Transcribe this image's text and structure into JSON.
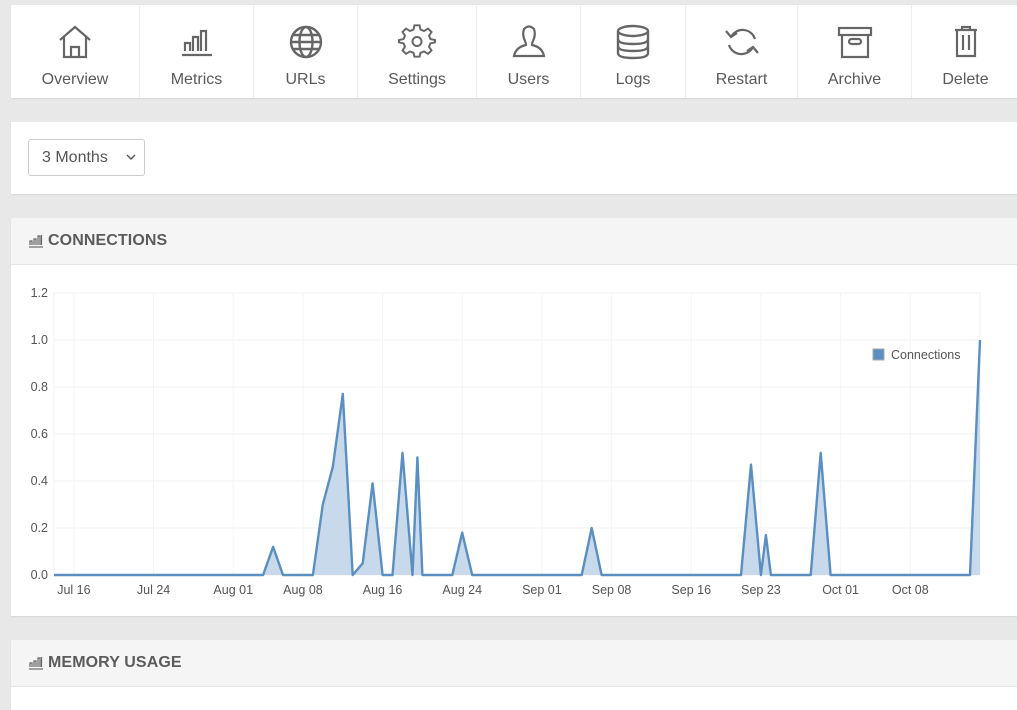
{
  "toolbar": {
    "items": [
      {
        "label": "Overview",
        "icon": "home-icon"
      },
      {
        "label": "Metrics",
        "icon": "bar-chart-icon"
      },
      {
        "label": "URLs",
        "icon": "globe-icon"
      },
      {
        "label": "Settings",
        "icon": "gear-icon"
      },
      {
        "label": "Users",
        "icon": "user-icon"
      },
      {
        "label": "Logs",
        "icon": "database-icon"
      },
      {
        "label": "Restart",
        "icon": "refresh-icon"
      },
      {
        "label": "Archive",
        "icon": "archive-box-icon"
      },
      {
        "label": "Delete",
        "icon": "trash-icon"
      }
    ]
  },
  "filter": {
    "range_selected": "3 Months"
  },
  "panels": {
    "connections_title": "CONNECTIONS",
    "memory_title": "MEMORY USAGE"
  },
  "colors": {
    "series_line": "#5b8fc0",
    "series_fill": "#c4d7ea"
  },
  "chart_data": {
    "type": "area",
    "title": "CONNECTIONS",
    "xlabel": "",
    "ylabel": "",
    "ylim": [
      0,
      1.2
    ],
    "yticks": [
      "0.0",
      "0.2",
      "0.4",
      "0.6",
      "0.8",
      "1.0",
      "1.2"
    ],
    "xticks": [
      "Jul 16",
      "Jul 24",
      "Aug 01",
      "Aug 08",
      "Aug 16",
      "Aug 24",
      "Sep 01",
      "Sep 08",
      "Sep 16",
      "Sep 23",
      "Oct 01",
      "Oct 08"
    ],
    "grid": true,
    "legend": {
      "position": "top-right",
      "entries": [
        "Connections"
      ]
    },
    "series": [
      {
        "name": "Connections",
        "points": [
          [
            "Jul 14",
            0
          ],
          [
            "Aug 04",
            0
          ],
          [
            "Aug 05",
            0.12
          ],
          [
            "Aug 06",
            0
          ],
          [
            "Aug 09",
            0
          ],
          [
            "Aug 10",
            0.3
          ],
          [
            "Aug 11",
            0.46
          ],
          [
            "Aug 12",
            0.77
          ],
          [
            "Aug 13",
            0
          ],
          [
            "Aug 14",
            0.05
          ],
          [
            "Aug 15",
            0.39
          ],
          [
            "Aug 16",
            0
          ],
          [
            "Aug 17",
            0
          ],
          [
            "Aug 18",
            0.52
          ],
          [
            "Aug 19",
            0
          ],
          [
            "Aug 19b",
            0.5
          ],
          [
            "Aug 20",
            0
          ],
          [
            "Aug 23",
            0
          ],
          [
            "Aug 24",
            0.18
          ],
          [
            "Aug 25",
            0
          ],
          [
            "Sep 05",
            0
          ],
          [
            "Sep 06",
            0.2
          ],
          [
            "Sep 07",
            0
          ],
          [
            "Sep 21",
            0
          ],
          [
            "Sep 22",
            0.47
          ],
          [
            "Sep 23",
            0
          ],
          [
            "Sep 23b",
            0.17
          ],
          [
            "Sep 24",
            0
          ],
          [
            "Sep 28",
            0
          ],
          [
            "Sep 29",
            0.52
          ],
          [
            "Sep 30",
            0
          ],
          [
            "Oct 14",
            0
          ],
          [
            "Oct 15",
            1.0
          ]
        ]
      }
    ]
  }
}
